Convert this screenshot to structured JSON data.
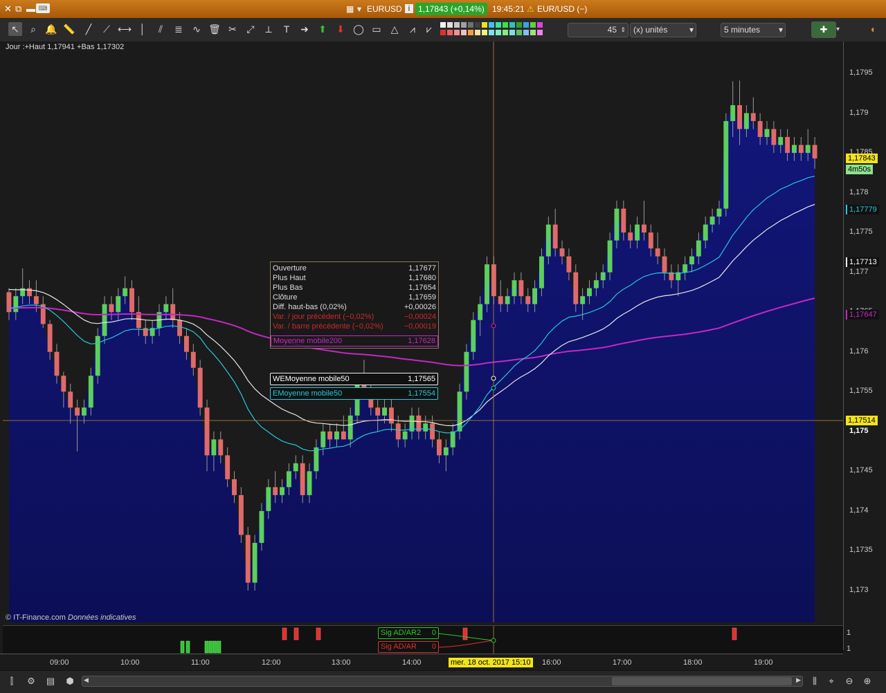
{
  "titlebar": {
    "symbol": "EURUSD",
    "price_badge": "1,17843 (+0,14%)",
    "time": "19:45:21",
    "instrument": "EUR/USD (−)"
  },
  "toolbar": {
    "units_value": "45",
    "units_label": "(x) unités",
    "timeframe": "5 minutes"
  },
  "chart": {
    "day_info": "Jour :+Haut 1,17941 +Bas 1,17302",
    "copyright": "© IT-Finance.com",
    "copyright_note": "Données indicatives",
    "current_price": "1,17843",
    "countdown": "4m50s",
    "cursor_price": "1,17514",
    "ema_price": "1,17779",
    "wma_price": "1,17713",
    "ma200_price": "1,17647",
    "y_ticks": [
      "1,1795",
      "1,179",
      "1,1785",
      "1,178",
      "1,1775",
      "1,177",
      "1,1765",
      "1,176",
      "1,1755",
      "1,175",
      "1,1745",
      "1,174",
      "1,1735",
      "1,173"
    ],
    "x_ticks": [
      "09:00",
      "10:00",
      "11:00",
      "12:00",
      "13:00",
      "14:00",
      "16:00",
      "17:00",
      "18:00",
      "19:00"
    ],
    "cursor_date": "mer. 18 oct. 2017 15:10",
    "colors": {
      "up": "#5ccf5c",
      "down": "#e06a6a",
      "ema": "#25c8dc",
      "wma": "#e8e8e8",
      "ma200": "#c428c4",
      "cursor": "#c08a40",
      "bg_top": "#1b1b1b",
      "bg_fill": "#12167a"
    }
  },
  "tooltip": {
    "rows": [
      {
        "k": "Ouverture",
        "v": "1,17677"
      },
      {
        "k": "Plus Haut",
        "v": "1,17680"
      },
      {
        "k": "Plus Bas",
        "v": "1,17654"
      },
      {
        "k": "Clôture",
        "v": "1,17659"
      },
      {
        "k": "Diff. haut-bas (0,02%)",
        "v": "+0,00026"
      },
      {
        "k": "Var. / jour précédent (−0,02%)",
        "v": "−0,00024"
      },
      {
        "k": "Var. / barre précédente (−0,02%)",
        "v": "−0,00019"
      }
    ],
    "ma200": {
      "k": "Moyenne mobile200",
      "v": "1,17628"
    },
    "wma50": {
      "k": "WEMoyenne mobile50",
      "v": "1,17565"
    },
    "ema50": {
      "k": "EMoyenne mobile50",
      "v": "1,17554"
    }
  },
  "indicator": {
    "sig1": {
      "k": "Sig AD/AR2",
      "v": "0"
    },
    "sig2": {
      "k": "Sig AD/AR",
      "v": "0"
    },
    "axis_top": "1",
    "axis_bottom": "1"
  },
  "chart_data": {
    "type": "candlestick",
    "title": "",
    "xlabel": "",
    "ylabel": "",
    "ylim": [
      1.1726,
      1.1799
    ],
    "x_labels": [
      "09:00",
      "10:00",
      "11:00",
      "12:00",
      "13:00",
      "14:00",
      "16:00",
      "17:00",
      "18:00",
      "19:00"
    ],
    "candles_ohlc_5min": [
      [
        1.17675,
        1.1768,
        1.1764,
        1.1765
      ],
      [
        1.1765,
        1.1768,
        1.1764,
        1.1767
      ],
      [
        1.1767,
        1.17705,
        1.1766,
        1.1768
      ],
      [
        1.1768,
        1.1769,
        1.1766,
        1.1767
      ],
      [
        1.1767,
        1.1769,
        1.1765,
        1.1766
      ],
      [
        1.1766,
        1.1767,
        1.1763,
        1.17635
      ],
      [
        1.17635,
        1.1764,
        1.1759,
        1.176
      ],
      [
        1.176,
        1.1761,
        1.1756,
        1.1757
      ],
      [
        1.1757,
        1.17575,
        1.1753,
        1.1755
      ],
      [
        1.1755,
        1.1756,
        1.1751,
        1.1753
      ],
      [
        1.1753,
        1.1754,
        1.17475,
        1.1752
      ],
      [
        1.1752,
        1.1754,
        1.1751,
        1.1753
      ],
      [
        1.1753,
        1.1758,
        1.1752,
        1.1757
      ],
      [
        1.1757,
        1.1763,
        1.1756,
        1.1762
      ],
      [
        1.1762,
        1.1767,
        1.1761,
        1.1766
      ],
      [
        1.1766,
        1.1767,
        1.1764,
        1.1765
      ],
      [
        1.1765,
        1.1768,
        1.1764,
        1.1767
      ],
      [
        1.1767,
        1.17695,
        1.1766,
        1.1768
      ],
      [
        1.1768,
        1.1769,
        1.1764,
        1.1765
      ],
      [
        1.1765,
        1.1767,
        1.1762,
        1.1763
      ],
      [
        1.1763,
        1.1764,
        1.1761,
        1.1762
      ],
      [
        1.1762,
        1.1764,
        1.1761,
        1.1763
      ],
      [
        1.1763,
        1.1766,
        1.1762,
        1.1765
      ],
      [
        1.1765,
        1.1767,
        1.1764,
        1.1766
      ],
      [
        1.1766,
        1.1768,
        1.1763,
        1.1764
      ],
      [
        1.1764,
        1.1765,
        1.1761,
        1.1762
      ],
      [
        1.1762,
        1.1763,
        1.1759,
        1.176
      ],
      [
        1.176,
        1.1761,
        1.1757,
        1.1758
      ],
      [
        1.1758,
        1.1759,
        1.1752,
        1.1753
      ],
      [
        1.1753,
        1.1754,
        1.1745,
        1.1747
      ],
      [
        1.1747,
        1.175,
        1.1745,
        1.1749
      ],
      [
        1.1749,
        1.175,
        1.1746,
        1.1747
      ],
      [
        1.1747,
        1.1748,
        1.1743,
        1.1744
      ],
      [
        1.1744,
        1.1745,
        1.1741,
        1.1742
      ],
      [
        1.1742,
        1.1743,
        1.1736,
        1.1737
      ],
      [
        1.1737,
        1.1738,
        1.173,
        1.1731
      ],
      [
        1.1731,
        1.1737,
        1.173,
        1.1736
      ],
      [
        1.1736,
        1.1741,
        1.1735,
        1.174
      ],
      [
        1.174,
        1.1744,
        1.1739,
        1.1743
      ],
      [
        1.1743,
        1.1745,
        1.1741,
        1.1742
      ],
      [
        1.1742,
        1.1744,
        1.1741,
        1.1743
      ],
      [
        1.1743,
        1.1746,
        1.1742,
        1.1745
      ],
      [
        1.1745,
        1.1747,
        1.1744,
        1.1746
      ],
      [
        1.1746,
        1.1747,
        1.1741,
        1.1742
      ],
      [
        1.1742,
        1.1746,
        1.1741,
        1.1745
      ],
      [
        1.1745,
        1.1749,
        1.1744,
        1.1748
      ],
      [
        1.1748,
        1.1751,
        1.1747,
        1.175
      ],
      [
        1.175,
        1.1751,
        1.1748,
        1.1749
      ],
      [
        1.1749,
        1.1751,
        1.1748,
        1.175
      ],
      [
        1.175,
        1.1752,
        1.1749,
        1.1749
      ],
      [
        1.1749,
        1.1753,
        1.1748,
        1.1752
      ],
      [
        1.1752,
        1.1757,
        1.1751,
        1.1756
      ],
      [
        1.1756,
        1.1759,
        1.1754,
        1.1755
      ],
      [
        1.1755,
        1.1756,
        1.1752,
        1.1753
      ],
      [
        1.1753,
        1.1754,
        1.175,
        1.1752
      ],
      [
        1.1752,
        1.1754,
        1.1751,
        1.1753
      ],
      [
        1.1753,
        1.1754,
        1.175,
        1.1751
      ],
      [
        1.1751,
        1.1752,
        1.1748,
        1.1749
      ],
      [
        1.1749,
        1.1751,
        1.1748,
        1.175
      ],
      [
        1.175,
        1.1753,
        1.1749,
        1.1752
      ],
      [
        1.1752,
        1.1753,
        1.1749,
        1.175
      ],
      [
        1.175,
        1.1752,
        1.1749,
        1.1751
      ],
      [
        1.1751,
        1.1752,
        1.1748,
        1.1749
      ],
      [
        1.1749,
        1.175,
        1.1746,
        1.1747
      ],
      [
        1.1747,
        1.1749,
        1.1745,
        1.1748
      ],
      [
        1.1748,
        1.1751,
        1.1747,
        1.175
      ],
      [
        1.175,
        1.1756,
        1.1749,
        1.1755
      ],
      [
        1.1755,
        1.1761,
        1.1754,
        1.176
      ],
      [
        1.176,
        1.1765,
        1.1759,
        1.1764
      ],
      [
        1.1764,
        1.1767,
        1.1762,
        1.1766
      ],
      [
        1.1766,
        1.1772,
        1.1765,
        1.1771
      ],
      [
        1.1771,
        1.1772,
        1.1766,
        1.1767
      ],
      [
        1.1767,
        1.1769,
        1.1765,
        1.1766
      ],
      [
        1.1766,
        1.1768,
        1.1765,
        1.1767
      ],
      [
        1.1767,
        1.177,
        1.1766,
        1.1769
      ],
      [
        1.1769,
        1.177,
        1.1766,
        1.1767
      ],
      [
        1.1767,
        1.1768,
        1.1765,
        1.1766
      ],
      [
        1.1766,
        1.1769,
        1.1765,
        1.1768
      ],
      [
        1.1768,
        1.1773,
        1.1767,
        1.1772
      ],
      [
        1.1772,
        1.1777,
        1.1771,
        1.1776
      ],
      [
        1.1776,
        1.1778,
        1.1772,
        1.1773
      ],
      [
        1.1773,
        1.1774,
        1.1771,
        1.1772
      ],
      [
        1.1772,
        1.1773,
        1.1769,
        1.177
      ],
      [
        1.177,
        1.1771,
        1.1765,
        1.1766
      ],
      [
        1.1766,
        1.1768,
        1.1764,
        1.1767
      ],
      [
        1.1767,
        1.1769,
        1.1766,
        1.1768
      ],
      [
        1.1768,
        1.177,
        1.1767,
        1.1769
      ],
      [
        1.1769,
        1.1771,
        1.1768,
        1.177
      ],
      [
        1.177,
        1.1775,
        1.1769,
        1.1774
      ],
      [
        1.1774,
        1.1779,
        1.1773,
        1.1778
      ],
      [
        1.1778,
        1.1779,
        1.1774,
        1.1775
      ],
      [
        1.1775,
        1.1776,
        1.1773,
        1.1774
      ],
      [
        1.1774,
        1.1777,
        1.1773,
        1.1776
      ],
      [
        1.1776,
        1.1779,
        1.1774,
        1.1775
      ],
      [
        1.1775,
        1.1776,
        1.1772,
        1.1773
      ],
      [
        1.1773,
        1.1775,
        1.1771,
        1.1772
      ],
      [
        1.1772,
        1.1773,
        1.1769,
        1.177
      ],
      [
        1.177,
        1.1771,
        1.1768,
        1.1769
      ],
      [
        1.1769,
        1.1771,
        1.1767,
        1.177
      ],
      [
        1.177,
        1.1772,
        1.1769,
        1.1771
      ],
      [
        1.1771,
        1.1773,
        1.177,
        1.1772
      ],
      [
        1.1772,
        1.1775,
        1.1771,
        1.1774
      ],
      [
        1.1774,
        1.1777,
        1.1773,
        1.1776
      ],
      [
        1.1776,
        1.1778,
        1.1775,
        1.1777
      ],
      [
        1.1777,
        1.1779,
        1.1776,
        1.1778
      ],
      [
        1.1778,
        1.179,
        1.1777,
        1.1789
      ],
      [
        1.1789,
        1.1794,
        1.1787,
        1.1791
      ],
      [
        1.1791,
        1.17941,
        1.1786,
        1.1788
      ],
      [
        1.1788,
        1.1791,
        1.1787,
        1.179
      ],
      [
        1.179,
        1.1792,
        1.1788,
        1.1789
      ],
      [
        1.1789,
        1.179,
        1.1786,
        1.1787
      ],
      [
        1.1787,
        1.1789,
        1.1786,
        1.1788
      ],
      [
        1.1788,
        1.1789,
        1.1785,
        1.1786
      ],
      [
        1.1786,
        1.1788,
        1.1785,
        1.1787
      ],
      [
        1.1787,
        1.1788,
        1.1784,
        1.1785
      ],
      [
        1.1785,
        1.1787,
        1.1784,
        1.1786
      ],
      [
        1.1786,
        1.1787,
        1.1784,
        1.1785
      ],
      [
        1.1785,
        1.1788,
        1.1784,
        1.1786
      ],
      [
        1.1786,
        1.1787,
        1.1783,
        1.17843
      ]
    ],
    "series": [
      {
        "name": "EMoyenne mobile50",
        "color": "#25c8dc"
      },
      {
        "name": "WEMoyenne mobile50",
        "color": "#e8e8e8"
      },
      {
        "name": "Moyenne mobile200",
        "color": "#c428c4"
      }
    ]
  }
}
